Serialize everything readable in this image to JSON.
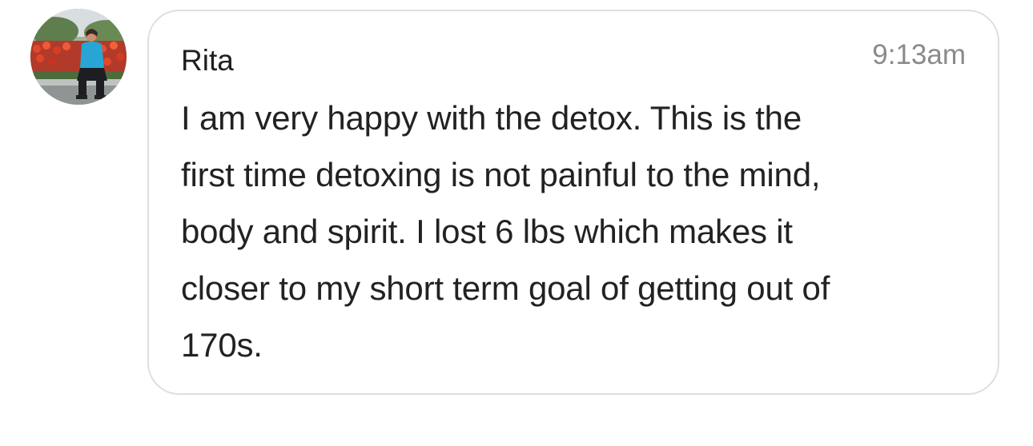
{
  "message": {
    "avatar": {
      "icon": "user-photo-avatar"
    },
    "sender_name": "Rita",
    "timestamp": "9:13am",
    "text_lines": [
      "I am very happy with the detox. This is the",
      "first time detoxing is not painful to the mind,",
      "body and spirit. I lost 6 lbs which makes it",
      "closer to my short term goal of getting out of",
      "170s."
    ]
  },
  "colors": {
    "bubble_border": "#dedede",
    "text": "#222222",
    "timestamp": "#8a8a8a",
    "background": "#ffffff"
  }
}
